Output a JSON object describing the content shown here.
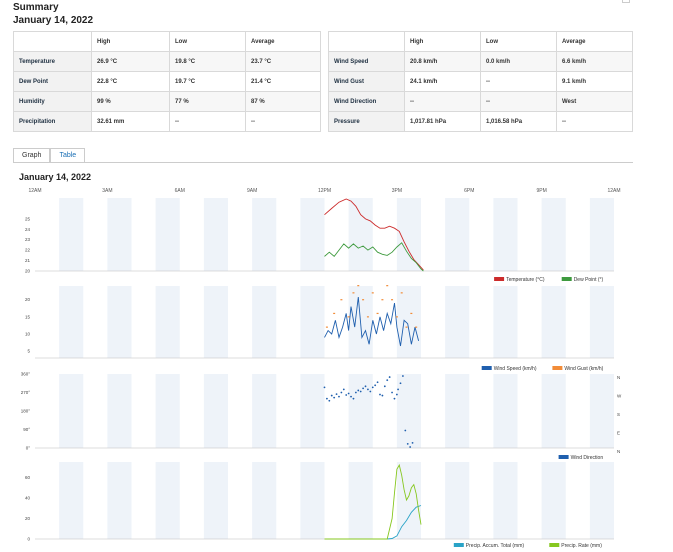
{
  "summary": {
    "title": "Summary",
    "date": "January 14, 2022"
  },
  "left_table": {
    "headers": [
      "",
      "High",
      "Low",
      "Average"
    ],
    "rows": [
      [
        "Temperature",
        "26.9 °C",
        "19.8 °C",
        "23.7 °C"
      ],
      [
        "Dew Point",
        "22.8 °C",
        "19.7 °C",
        "21.4 °C"
      ],
      [
        "Humidity",
        "99 %",
        "77 %",
        "87 %"
      ],
      [
        "Precipitation",
        "32.61 mm",
        "--",
        "--"
      ]
    ]
  },
  "right_table": {
    "headers": [
      "",
      "High",
      "Low",
      "Average"
    ],
    "rows": [
      [
        "Wind Speed",
        "20.8 km/h",
        "0.0 km/h",
        "6.6 km/h"
      ],
      [
        "Wind Gust",
        "24.1 km/h",
        "--",
        "9.1 km/h"
      ],
      [
        "Wind Direction",
        "--",
        "--",
        "West"
      ],
      [
        "Pressure",
        "1,017.81 hPa",
        "1,016.58 hPa",
        "--"
      ]
    ]
  },
  "tabs": [
    {
      "label": "Graph",
      "active": true
    },
    {
      "label": "Table",
      "active": false
    }
  ],
  "chart_title": "January 14, 2022",
  "colors": {
    "temperature": "#cc2b2b",
    "dew_point": "#3e9a3e",
    "wind_speed": "#1f5fae",
    "wind_gust": "#f28c38",
    "wind_dir": "#1f5fae",
    "precip_total": "#29a3c7",
    "precip_rate": "#86c71f",
    "band": "#eef3f9"
  },
  "chart_data": [
    {
      "type": "line",
      "x_ticks": [
        "12AM",
        "3AM",
        "6AM",
        "9AM",
        "12PM",
        "3PM",
        "6PM",
        "9PM",
        "12AM"
      ],
      "x_range_hours": [
        0,
        24
      ],
      "ylim": [
        20,
        27
      ],
      "y_ticks": [
        "20",
        "21",
        "22",
        "23",
        "24",
        "25"
      ],
      "legend": "bottom-right",
      "series": [
        {
          "name": "Temperature (°C)",
          "key": "temperature",
          "x": [
            12.0,
            12.3,
            12.6,
            12.9,
            13.1,
            13.3,
            13.5,
            13.7,
            13.9,
            14.1,
            14.3,
            14.5,
            14.7,
            14.9,
            15.1,
            15.3,
            15.5,
            15.7,
            15.9,
            16.1
          ],
          "y": [
            25.4,
            26.0,
            26.6,
            26.9,
            26.7,
            26.2,
            25.4,
            25.0,
            24.8,
            24.4,
            24.1,
            24.1,
            24.3,
            24.1,
            23.8,
            22.8,
            21.9,
            21.1,
            20.6,
            20.1
          ]
        },
        {
          "name": "Dew Point (°)",
          "key": "dew_point",
          "x": [
            12.0,
            12.2,
            12.4,
            12.6,
            12.8,
            13.0,
            13.2,
            13.4,
            13.6,
            13.8,
            14.0,
            14.2,
            14.4,
            14.6,
            14.8,
            15.0,
            15.2,
            15.4,
            15.6,
            15.8,
            16.0,
            16.1
          ],
          "y": [
            21.4,
            21.8,
            21.4,
            22.0,
            22.6,
            22.2,
            22.6,
            22.2,
            22.4,
            22.0,
            22.3,
            21.8,
            21.6,
            21.5,
            21.8,
            22.3,
            22.7,
            21.9,
            21.2,
            20.8,
            20.2,
            20.0
          ]
        }
      ]
    },
    {
      "type": "line",
      "ylim": [
        3,
        24
      ],
      "y_ticks": [
        "5",
        "10",
        "15",
        "20"
      ],
      "legend": "bottom-right",
      "series": [
        {
          "name": "Wind Speed (km/h)",
          "key": "wind_speed",
          "x": [
            12.0,
            12.15,
            12.3,
            12.45,
            12.6,
            12.75,
            12.9,
            13.0,
            13.1,
            13.25,
            13.4,
            13.55,
            13.7,
            13.85,
            14.0,
            14.15,
            14.3,
            14.45,
            14.6,
            14.75,
            14.9,
            15.0,
            15.15,
            15.3,
            15.45,
            15.6,
            15.75,
            15.9
          ],
          "y": [
            9.0,
            11.0,
            10.0,
            14.0,
            9.0,
            12.0,
            16.0,
            11.0,
            18.0,
            12.0,
            20.8,
            9.0,
            11.0,
            7.0,
            14.0,
            10.0,
            15.0,
            11.0,
            16.0,
            13.0,
            19.0,
            12.0,
            6.5,
            14.0,
            13.0,
            7.0,
            12.0,
            8.0
          ]
        },
        {
          "name": "Wind Gust (km/h)",
          "key": "wind_gust",
          "x": [
            12.1,
            12.4,
            12.7,
            13.0,
            13.2,
            13.4,
            13.6,
            13.8,
            14.0,
            14.2,
            14.4,
            14.6,
            14.8,
            15.0,
            15.2,
            15.4,
            15.6,
            15.8
          ],
          "y": [
            12.0,
            16.0,
            20.0,
            15.0,
            22.0,
            24.1,
            20.0,
            15.0,
            22.0,
            16.0,
            20.0,
            24.1,
            20.0,
            15.0,
            22.0,
            12.0,
            16.0,
            12.0
          ]
        }
      ]
    },
    {
      "type": "scatter",
      "ylim": [
        0,
        360
      ],
      "y_ticks": [
        "0°",
        "90°",
        "180°",
        "270°",
        "360°"
      ],
      "right_ticks": [
        "N",
        "W",
        "S",
        "E",
        "N"
      ],
      "legend": "bottom-right",
      "series": [
        {
          "name": "Wind Direction",
          "key": "wind_dir",
          "x": [
            12.0,
            12.1,
            12.2,
            12.3,
            12.4,
            12.5,
            12.6,
            12.7,
            12.8,
            12.9,
            13.0,
            13.1,
            13.2,
            13.3,
            13.4,
            13.5,
            13.6,
            13.7,
            13.8,
            13.9,
            14.0,
            14.1,
            14.2,
            14.3,
            14.4,
            14.5,
            14.6,
            14.7,
            14.8,
            14.9,
            15.0,
            15.05,
            15.15,
            15.25,
            15.35,
            15.45,
            15.55,
            15.65
          ],
          "y": [
            295,
            240,
            230,
            255,
            245,
            262,
            250,
            270,
            285,
            258,
            265,
            250,
            240,
            270,
            280,
            275,
            290,
            300,
            285,
            275,
            295,
            305,
            320,
            260,
            255,
            300,
            330,
            345,
            270,
            240,
            260,
            285,
            315,
            350,
            85,
            20,
            5,
            25
          ]
        }
      ]
    },
    {
      "type": "line",
      "ylim": [
        0,
        75
      ],
      "y_ticks": [
        "0",
        "20",
        "40",
        "60"
      ],
      "legend": "bottom-right",
      "series": [
        {
          "name": "Precip. Accum. Total (mm)",
          "key": "precip_total",
          "x": [
            12.0,
            14.4,
            14.6,
            14.8,
            15.0,
            15.2,
            15.4,
            15.6,
            15.8,
            16.0
          ],
          "y": [
            0,
            0,
            0,
            0.5,
            3,
            12,
            18,
            26,
            31,
            32.6
          ]
        },
        {
          "name": "Precip. Rate (mm)",
          "key": "precip_rate",
          "x": [
            12.0,
            14.4,
            14.6,
            14.8,
            14.9,
            15.0,
            15.1,
            15.2,
            15.3,
            15.4,
            15.5,
            15.6,
            15.7,
            15.8,
            15.9,
            16.0
          ],
          "y": [
            0,
            0,
            0,
            20,
            45,
            68,
            72,
            62,
            48,
            38,
            42,
            50,
            53,
            44,
            28,
            14
          ]
        }
      ]
    }
  ]
}
